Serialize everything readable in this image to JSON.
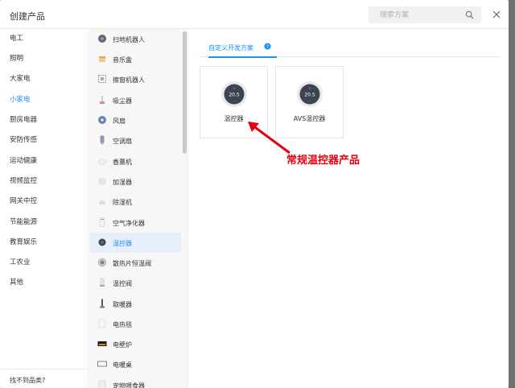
{
  "dialog": {
    "title": "创建产品",
    "search_placeholder": "搜索方案"
  },
  "categories": {
    "items": [
      {
        "label": "电工"
      },
      {
        "label": "照明"
      },
      {
        "label": "大家电"
      },
      {
        "label": "小家电",
        "active": true
      },
      {
        "label": "厨房电器"
      },
      {
        "label": "安防传感"
      },
      {
        "label": "运动健康"
      },
      {
        "label": "视频监控"
      },
      {
        "label": "网关中控"
      },
      {
        "label": "节能能源"
      },
      {
        "label": "教育娱乐"
      },
      {
        "label": "工农业"
      },
      {
        "label": "其他"
      }
    ],
    "footer": "找不到品类?"
  },
  "subcategories": {
    "items": [
      {
        "label": "扫地机器人",
        "icon": "robot-vacuum-icon"
      },
      {
        "label": "音乐盒",
        "icon": "music-box-icon"
      },
      {
        "label": "擦窗机器人",
        "icon": "window-robot-icon"
      },
      {
        "label": "吸尘器",
        "icon": "vacuum-cleaner-icon"
      },
      {
        "label": "风扇",
        "icon": "fan-icon"
      },
      {
        "label": "空调扇",
        "icon": "air-cooler-icon"
      },
      {
        "label": "香薰机",
        "icon": "aroma-diffuser-icon"
      },
      {
        "label": "加湿器",
        "icon": "humidifier-icon"
      },
      {
        "label": "除湿机",
        "icon": "dehumidifier-icon"
      },
      {
        "label": "空气净化器",
        "icon": "air-purifier-icon"
      },
      {
        "label": "温控器",
        "icon": "thermostat-icon",
        "active": true
      },
      {
        "label": "散热片恒温阀",
        "icon": "radiator-valve-icon"
      },
      {
        "label": "温控阀",
        "icon": "temperature-valve-icon"
      },
      {
        "label": "取暖器",
        "icon": "heater-icon"
      },
      {
        "label": "电热毯",
        "icon": "electric-blanket-icon"
      },
      {
        "label": "电壁炉",
        "icon": "electric-fireplace-icon"
      },
      {
        "label": "电暖桌",
        "icon": "heated-table-icon"
      },
      {
        "label": "宠物喂食器",
        "icon": "pet-feeder-icon"
      }
    ]
  },
  "content": {
    "tab_label": "自定义开发方案",
    "cards": [
      {
        "name": "温控器",
        "display": "20.5"
      },
      {
        "name": "AVS温控器",
        "display": "20.5"
      }
    ]
  },
  "annotation": {
    "text": "常规温控器产品",
    "color": "#e60012"
  },
  "colors": {
    "accent": "#1890ff",
    "active_row_bg": "#e6effa"
  }
}
